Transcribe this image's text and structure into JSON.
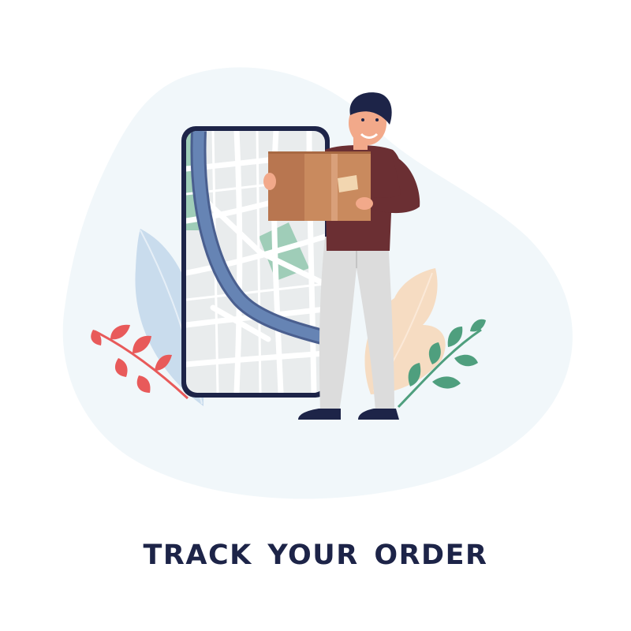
{
  "headline": {
    "title": "TRACK YOUR ORDER"
  },
  "colors": {
    "blob": "#f1f7fa",
    "phone_frame": "#1d2448",
    "map_route": "#6684b4",
    "map_park": "#9fcdb8",
    "box": "#c98a5e",
    "shirt": "#6b2f33",
    "pants": "#dcdcdc",
    "leaf_red": "#e85a5a",
    "leaf_green": "#4f9f7e",
    "leaf_blue": "#c9dced",
    "leaf_peach": "#f6dcc2",
    "title": "#1d2448"
  },
  "icons": [
    "smartphone-map-icon",
    "courier-person-icon",
    "cardboard-box-icon"
  ]
}
